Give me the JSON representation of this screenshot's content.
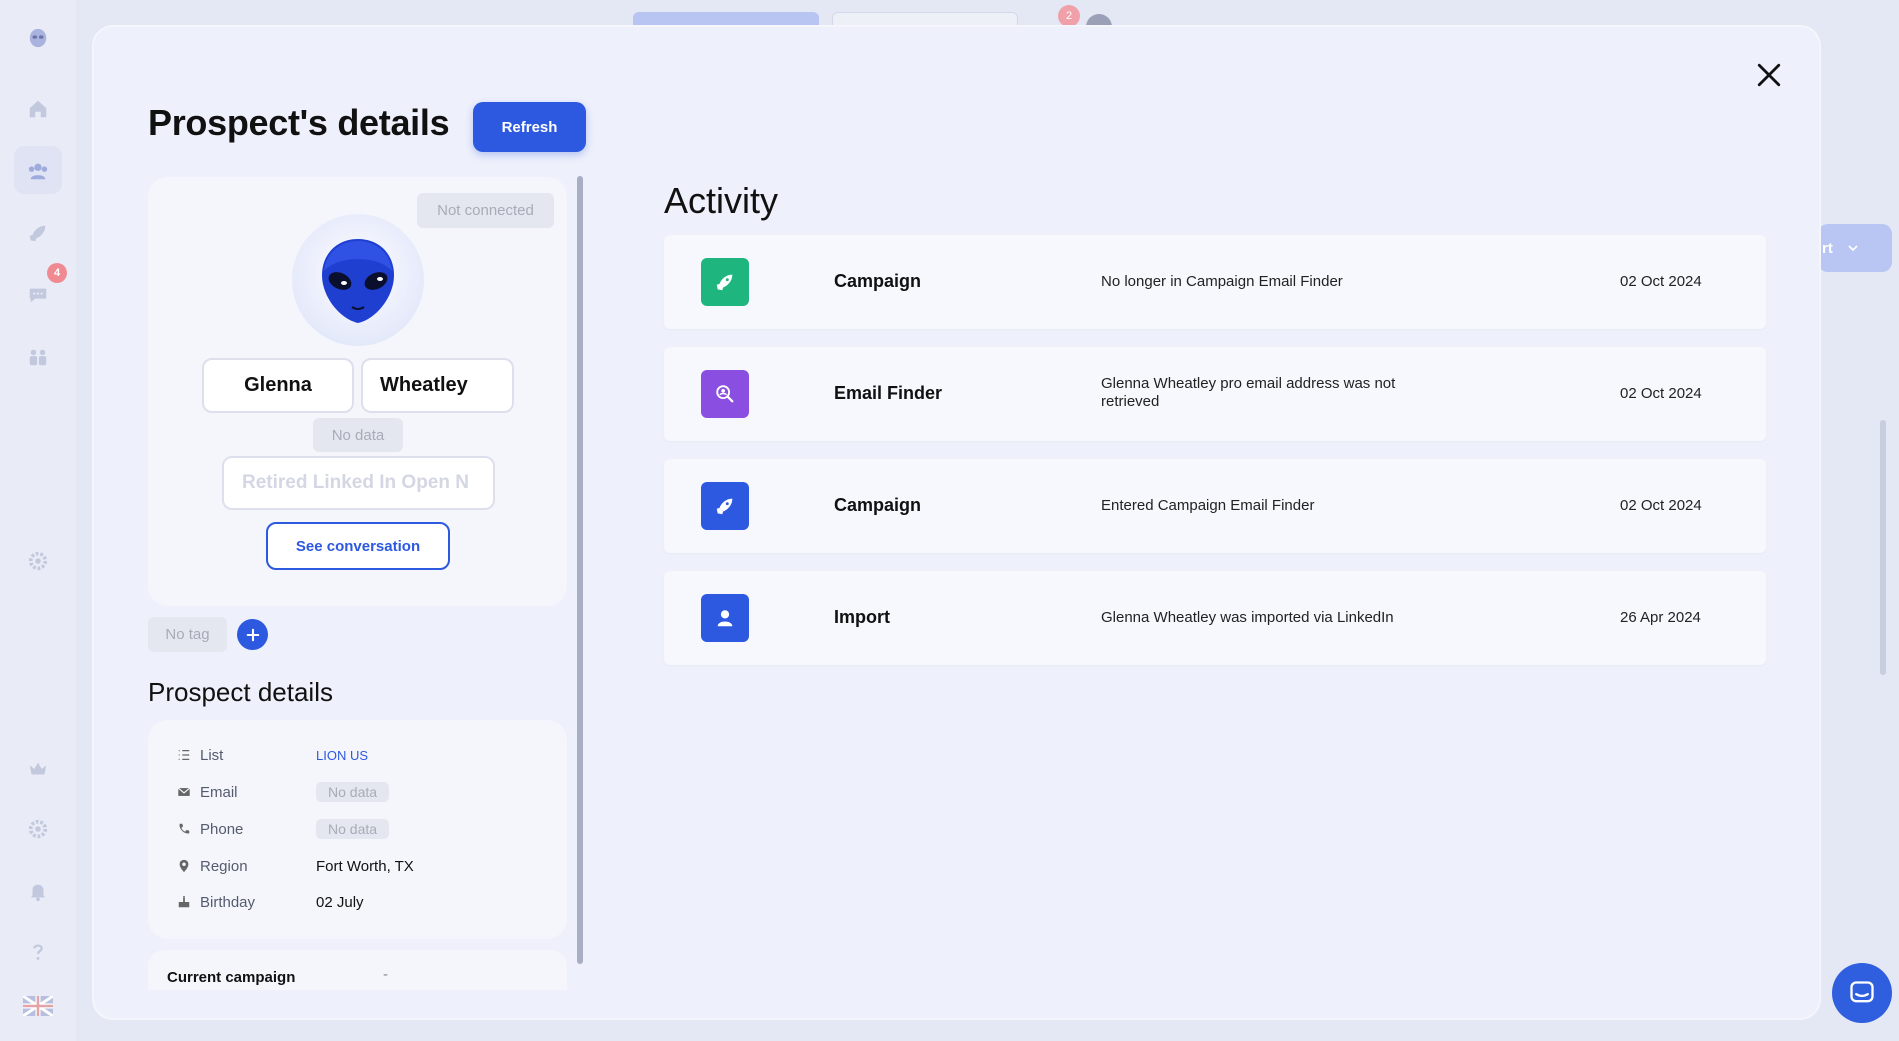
{
  "background": {
    "sidebar_badge": "4",
    "top_badge": "2",
    "right_button_label": "rt"
  },
  "modal": {
    "title": "Prospect's details",
    "refresh_label": "Refresh"
  },
  "profile": {
    "status": "Not connected",
    "first_name": "Glenna",
    "last_name": "Wheatley",
    "company": "No data",
    "headline": "Retired Linked In Open N",
    "see_conversation_label": "See conversation",
    "tag": "No tag"
  },
  "details": {
    "title": "Prospect details",
    "rows": [
      {
        "label": "List",
        "value": "LION US",
        "icon": "list-icon"
      },
      {
        "label": "Email",
        "value": "No data",
        "icon": "envelope-icon"
      },
      {
        "label": "Phone",
        "value": "No data",
        "icon": "phone-icon"
      },
      {
        "label": "Region",
        "value": "Fort Worth, TX",
        "icon": "location-pin-icon"
      },
      {
        "label": "Birthday",
        "value": "02 July",
        "icon": "cake-icon"
      }
    ],
    "current_campaign_label": "Current campaign",
    "current_campaign_value": "-"
  },
  "activity": {
    "title": "Activity",
    "items": [
      {
        "type": "Campaign",
        "description": "No longer in Campaign Email Finder",
        "date": "02 Oct 2024",
        "icon": "rocket-icon",
        "color": "#1fb57f"
      },
      {
        "type": "Email Finder",
        "description": "Glenna Wheatley pro email address was not retrieved",
        "date": "02 Oct 2024",
        "icon": "search-person-icon",
        "color": "#8a4fe0"
      },
      {
        "type": "Campaign",
        "description": "Entered Campaign Email Finder",
        "date": "02 Oct 2024",
        "icon": "rocket-icon",
        "color": "#2d59e0"
      },
      {
        "type": "Import",
        "description": "Glenna Wheatley was imported via LinkedIn",
        "date": "26 Apr 2024",
        "icon": "user-icon",
        "color": "#2d59e0"
      }
    ]
  },
  "colors": {
    "primary": "#2d59e0",
    "modal_bg": "#eef0fb",
    "card_bg": "#f5f6fc",
    "muted_pill": "#e5e7f0"
  }
}
